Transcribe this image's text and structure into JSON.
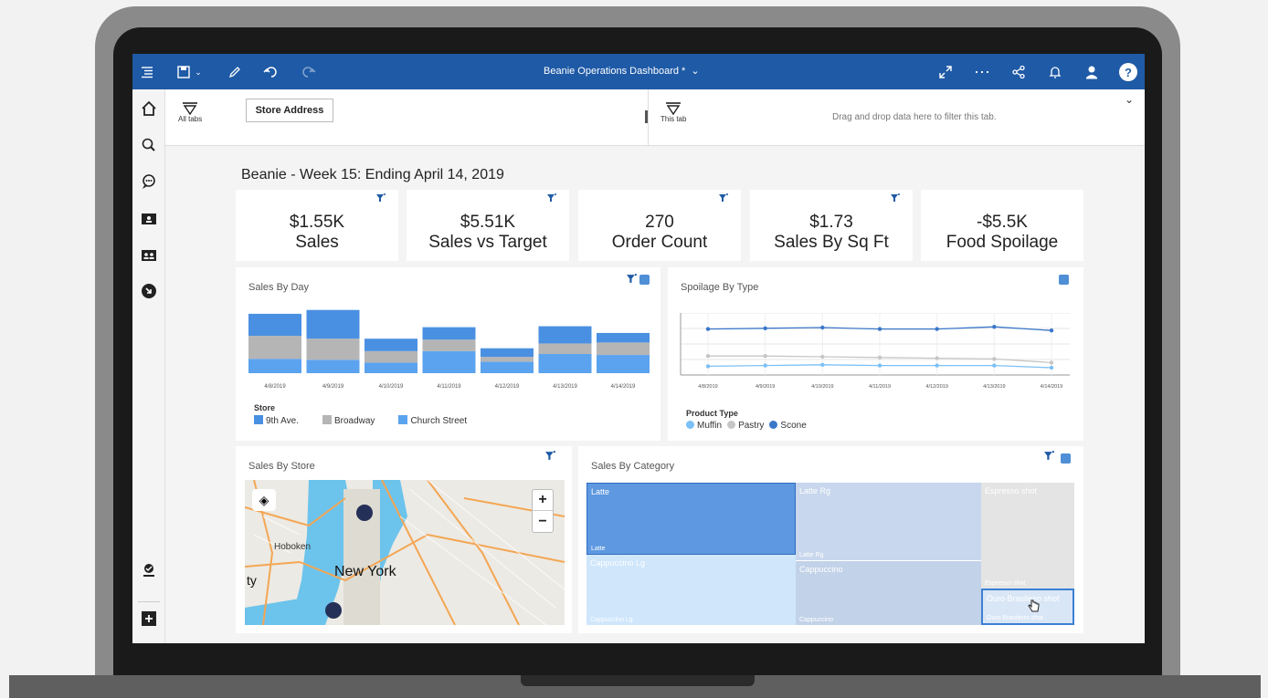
{
  "app": {
    "dashboard_title": "Beanie Operations Dashboard *"
  },
  "filters": {
    "all_tabs_label": "All tabs",
    "store_address": "Store Address",
    "this_tab_label": "This tab",
    "drop_hint": "Drag and drop data here to filter this tab."
  },
  "page": {
    "title": "Beanie - Week 15: Ending April 14, 2019"
  },
  "kpis": [
    {
      "value": "$1.55K",
      "label": "Sales"
    },
    {
      "value": "$5.51K",
      "label": "Sales vs Target"
    },
    {
      "value": "270",
      "label": "Order Count"
    },
    {
      "value": "$1.73",
      "label": "Sales By Sq Ft"
    },
    {
      "value": "-$5.5K",
      "label": "Food Spoilage"
    }
  ],
  "cards": {
    "sales_by_day": "Sales By Day",
    "spoilage_by_type": "Spoilage By Type",
    "sales_by_store": "Sales By Store",
    "sales_by_category": "Sales By Category"
  },
  "sales_legend": {
    "title": "Store",
    "items": [
      "9th Ave.",
      "Broadway",
      "Church Street"
    ]
  },
  "spoilage_legend": {
    "title": "Product Type",
    "items": [
      "Muffin",
      "Pastry",
      "Scone"
    ]
  },
  "map": {
    "labels": [
      "Hoboken",
      "New York",
      "ty"
    ]
  },
  "treemap": {
    "cells": [
      {
        "top": "Latte",
        "bottom": "Latte"
      },
      {
        "top": "Latte Rg",
        "bottom": "Latte Rg"
      },
      {
        "top": "Espresso shot",
        "bottom": "Espresso shot"
      },
      {
        "top": "Cappuccino Lg",
        "bottom": "Cappuccino Lg"
      },
      {
        "top": "Cappuccino",
        "bottom": "Cappuccino"
      },
      {
        "top": "Ouro Brasileiro shot",
        "bottom": "Ouro Brasileiro shot"
      }
    ]
  },
  "colors": {
    "topbar": "#1f5aa6",
    "series_9th": "#4a90e2",
    "series_broadway": "#b5b5b5",
    "series_church": "#5ba3ef",
    "muffin": "#7cc0f5",
    "pastry": "#c6c6c6",
    "scone": "#3a77c9"
  },
  "chart_data": [
    {
      "type": "bar",
      "title": "Sales By Day",
      "categories": [
        "4/8/2019",
        "4/9/2019",
        "4/10/2019",
        "4/11/2019",
        "4/12/2019",
        "4/13/2019",
        "4/14/2019"
      ],
      "series": [
        {
          "name": "9th Ave.",
          "values": [
            23,
            30,
            13,
            13,
            9,
            18,
            10
          ]
        },
        {
          "name": "Broadway",
          "values": [
            24,
            22,
            12,
            12,
            5,
            11,
            13
          ]
        },
        {
          "name": "Church Street",
          "values": [
            15,
            14,
            11,
            23,
            12,
            20,
            19
          ]
        }
      ]
    },
    {
      "type": "line",
      "title": "Spoilage By Type",
      "categories": [
        "4/8/2019",
        "4/9/2019",
        "4/10/2019",
        "4/11/2019",
        "4/12/2019",
        "4/13/2019",
        "4/14/2019"
      ],
      "series": [
        {
          "name": "Muffin",
          "values": [
            12,
            13,
            14,
            13,
            13,
            13,
            10
          ]
        },
        {
          "name": "Pastry",
          "values": [
            26,
            26,
            25,
            24,
            23,
            22,
            17
          ]
        },
        {
          "name": "Scone",
          "values": [
            63,
            64,
            65,
            63,
            63,
            66,
            61
          ]
        }
      ],
      "ylim": [
        0,
        85
      ]
    }
  ]
}
